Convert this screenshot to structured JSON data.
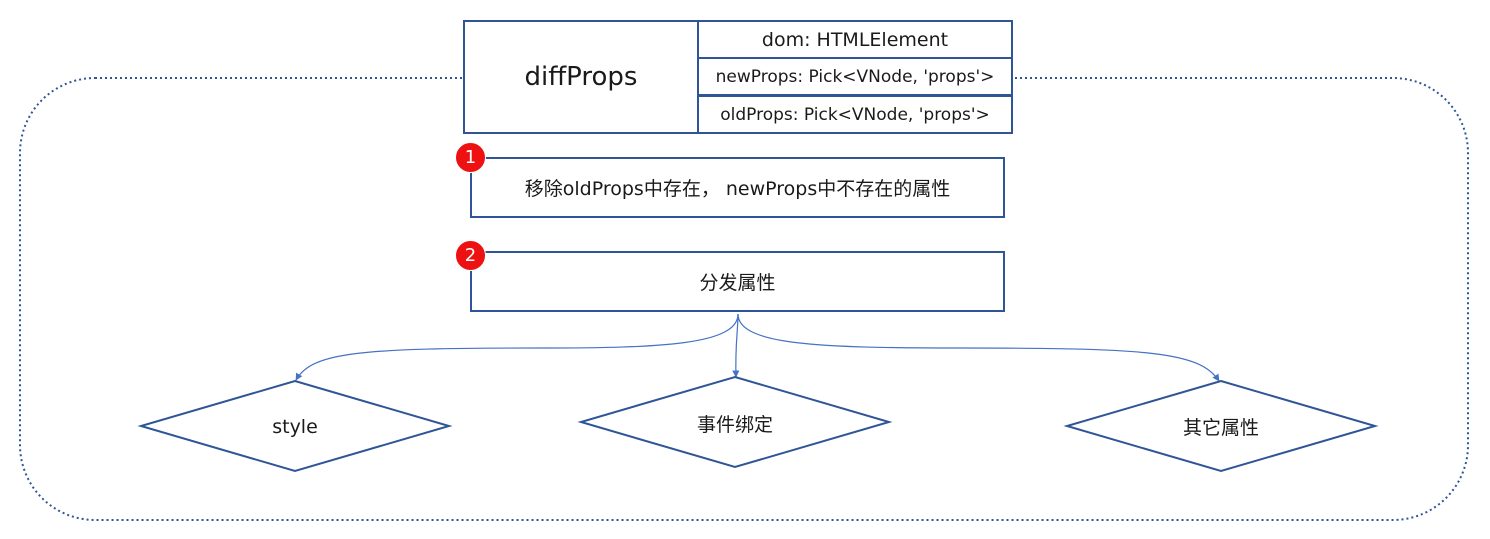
{
  "diagram": {
    "function_name": "diffProps",
    "params": [
      "dom: HTMLElement",
      "newProps: Pick<VNode, 'props'>",
      "oldProps: Pick<VNode, 'props'>"
    ],
    "steps": [
      {
        "number": "1",
        "text": "移除oldProps中存在， newProps中不存在的属性"
      },
      {
        "number": "2",
        "text": "分发属性"
      }
    ],
    "branches": [
      "style",
      "事件绑定",
      "其它属性"
    ]
  },
  "colors": {
    "border": "#2F5597",
    "connector": "#4472C4",
    "badge": "#ee1111",
    "group_outline": "#2F5597"
  }
}
